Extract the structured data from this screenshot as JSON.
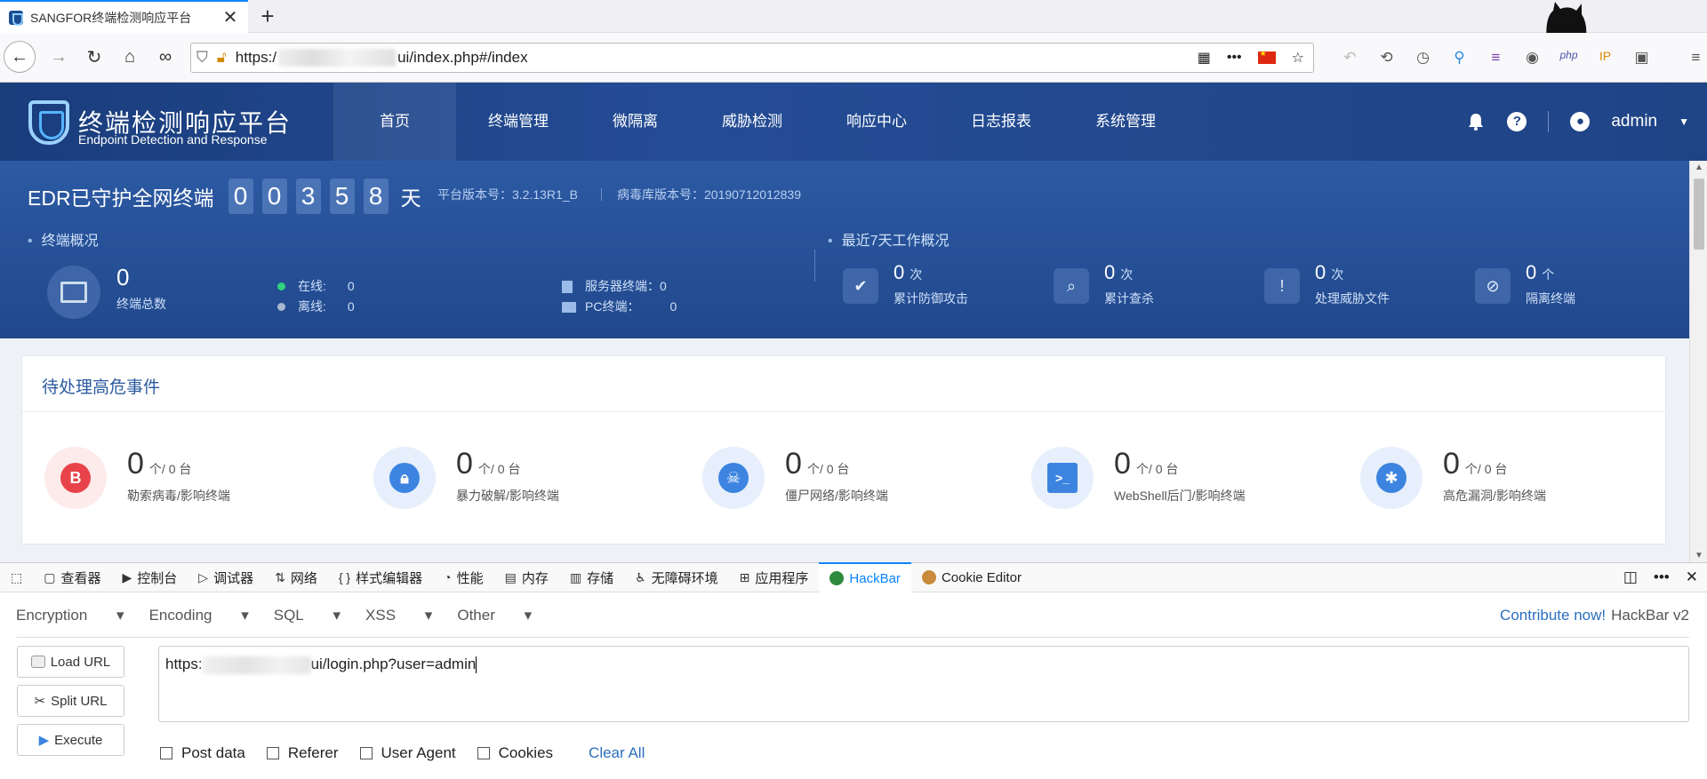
{
  "browser": {
    "tab_title": "SANGFOR终端检测响应平台",
    "tab_close": "✕",
    "new_tab": "+",
    "url_prefix": "https:/",
    "url_suffix": "ui/index.php#/index"
  },
  "app": {
    "logo_cn": "终端检测响应平台",
    "logo_en": "Endpoint Detection and Response",
    "nav": [
      "首页",
      "终端管理",
      "微隔离",
      "威胁检测",
      "响应中心",
      "日志报表",
      "系统管理"
    ],
    "help": "?",
    "user": "admin"
  },
  "summary": {
    "title": "EDR已守护全网终端",
    "days": [
      "0",
      "0",
      "3",
      "5",
      "8"
    ],
    "days_unit": "天",
    "platform_version": "平台版本号：3.2.13R1_B",
    "virus_version": "病毒库版本号：20190712012839",
    "overview_label": "终端概况",
    "total": "0",
    "total_label": "终端总数",
    "online": "在线:",
    "online_val": "0",
    "offline": "离线:",
    "offline_val": "0",
    "server": "服务器终端：",
    "server_val": "0",
    "pc": "PC终端：",
    "pc_val": "0",
    "week_label": "最近7天工作概况",
    "week": [
      {
        "num": "0",
        "unit": "次",
        "label": "累计防御攻击"
      },
      {
        "num": "0",
        "unit": "次",
        "label": "累计查杀"
      },
      {
        "num": "0",
        "unit": "次",
        "label": "处理威胁文件"
      },
      {
        "num": "0",
        "unit": "个",
        "label": "隔离终端"
      }
    ]
  },
  "events": {
    "title": "待处理高危事件",
    "items": [
      {
        "num": "0",
        "unit": "个/ 0 台",
        "label": "勒索病毒/影响终端",
        "color": "#e8434a",
        "bg": "#fdeaea"
      },
      {
        "num": "0",
        "unit": "个/ 0 台",
        "label": "暴力破解/影响终端",
        "color": "#3d84e0",
        "bg": "#e6effb"
      },
      {
        "num": "0",
        "unit": "个/ 0 台",
        "label": "僵尸网络/影响终端",
        "color": "#3d84e0",
        "bg": "#e6effb"
      },
      {
        "num": "0",
        "unit": "个/ 0 台",
        "label": "WebShell后门/影响终端",
        "color": "#3d84e0",
        "bg": "#e6effb"
      },
      {
        "num": "0",
        "unit": "个/ 0 台",
        "label": "高危漏洞/影响终端",
        "color": "#3d84e0",
        "bg": "#e6effb"
      }
    ]
  },
  "devtools": {
    "tabs": [
      "查看器",
      "控制台",
      "调试器",
      "网络",
      "样式编辑器",
      "性能",
      "内存",
      "存储",
      "无障碍环境",
      "应用程序",
      "HackBar",
      "Cookie Editor"
    ]
  },
  "hackbar": {
    "menus": [
      "Encryption",
      "Encoding",
      "SQL",
      "XSS",
      "Other"
    ],
    "contribute": "Contribute now!",
    "version": "HackBar v2",
    "load_url": "Load URL",
    "split_url": "Split URL",
    "execute": "Execute",
    "url_prefix": "https:",
    "url_suffix": "ui/login.php?user=admin",
    "checks": [
      "Post data",
      "Referer",
      "User Agent",
      "Cookies"
    ],
    "clear_all": "Clear All"
  }
}
